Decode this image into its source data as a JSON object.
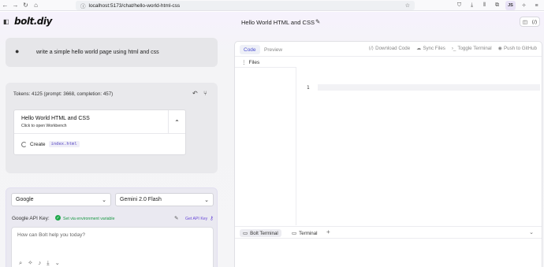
{
  "browser": {
    "url": "localhost:5173/chat/hello-world-html-css",
    "profile_initials": "JS"
  },
  "header": {
    "logo_main": "bolt",
    "logo_suffix": ".diy",
    "chat_title": "Hello World HTML and CSS"
  },
  "chat": {
    "user_message": "write a simple hello world page using html and css",
    "tokens": "Tokens: 4125 (prompt: 3668, completion: 457)",
    "artifact": {
      "title": "Hello World HTML and CSS",
      "subtitle": "Click to open Workbench",
      "action_label": "Create",
      "action_file": "index.html"
    }
  },
  "input": {
    "provider": "Google",
    "model": "Gemini 2.0 Flash",
    "api_key_label": "Google API Key:",
    "api_key_status": "Set via environment variable",
    "get_api_key": "Get API Key",
    "placeholder": "How can Bolt help you today?"
  },
  "workbench": {
    "tabs": [
      "Code",
      "Preview"
    ],
    "actions": {
      "download": "Download Code",
      "sync": "Sync Files",
      "toggle_terminal": "Toggle Terminal",
      "push": "Push to GitHub"
    },
    "files_label": "Files",
    "line_number": "1",
    "terminal_tabs": [
      "Bolt Terminal",
      "Terminal"
    ]
  },
  "colors": {
    "accent": "#4a4ed1",
    "success": "#1fa84b",
    "link": "#6a4bd8"
  }
}
